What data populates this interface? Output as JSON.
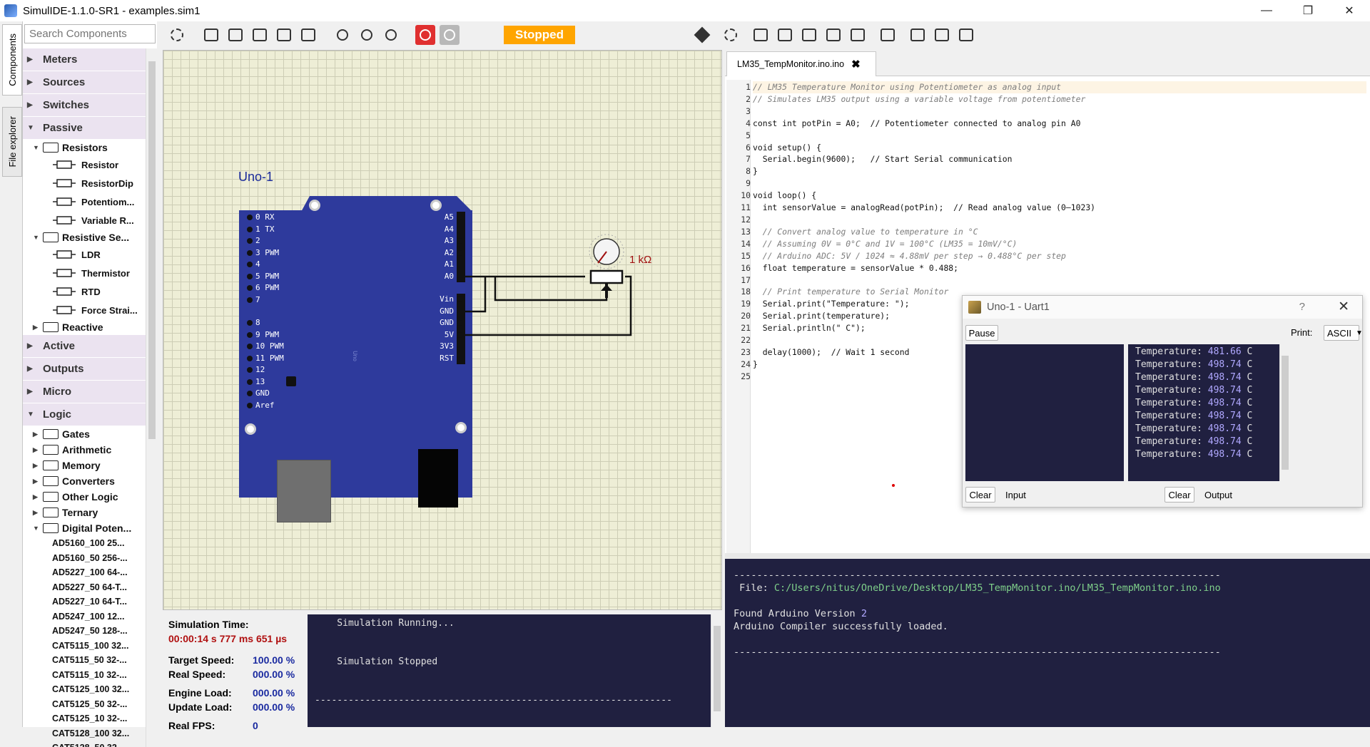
{
  "window": {
    "title": "SimulIDE-1.1.0-SR1 - examples.sim1",
    "minimize": "—",
    "maximize": "❐",
    "close": "✕"
  },
  "side_tabs": {
    "components": "Components",
    "file_explorer": "File explorer"
  },
  "search": {
    "placeholder": "Search Components"
  },
  "tree": {
    "categories": [
      "Meters",
      "Sources",
      "Switches",
      "Passive",
      "Active",
      "Outputs",
      "Micro",
      "Logic"
    ],
    "passive_subs": [
      "Resistors",
      "Resistive Se...",
      "Reactive"
    ],
    "resistor_items": [
      "Resistor",
      "ResistorDip",
      "Potentiom...",
      "Variable R..."
    ],
    "resistive_items": [
      "LDR",
      "Thermistor",
      "RTD",
      "Force Strai..."
    ],
    "logic_subs": [
      "Gates",
      "Arithmetic",
      "Memory",
      "Converters",
      "Other Logic",
      "Ternary",
      "Digital Poten..."
    ],
    "digipot_items": [
      "AD5160_100  25...",
      "AD5160_50  256-...",
      "AD5227_100  64-...",
      "AD5227_50  64-T...",
      "AD5227_10  64-T...",
      "AD5247_100  12...",
      "AD5247_50  128-...",
      "CAT5115_100  32...",
      "CAT5115_50  32-...",
      "CAT5115_10  32-...",
      "CAT5125_100  32...",
      "CAT5125_50  32-...",
      "CAT5125_10  32-...",
      "CAT5128_100  32...",
      "CAT5128_50  32-..."
    ]
  },
  "sim_toolbar": {
    "status": "Stopped"
  },
  "circuit": {
    "board_label": "Uno-1",
    "left_pins": [
      "0 RX",
      "1 TX",
      "2",
      "3 PWM",
      "4",
      "5 PWM",
      "6 PWM",
      "7"
    ],
    "left_pins2": [
      "8",
      "9 PWM",
      "10 PWM",
      "11 PWM",
      "12",
      "13",
      "GND",
      "Aref"
    ],
    "right_pins": [
      "A5",
      "A4",
      "A3",
      "A2",
      "A1",
      "A0"
    ],
    "right_pins2": [
      "Vin",
      "GND",
      "GND",
      "5V",
      "3V3",
      "RST"
    ],
    "pot_value": "1 kΩ",
    "board_text": "Uno"
  },
  "editor": {
    "tab_label": "LM35_TempMonitor.ino.ino",
    "tab_close": "✖",
    "line_numbers": [
      "1",
      "2",
      "3",
      "4",
      "5",
      "6",
      "7",
      "8",
      "9",
      "10",
      "11",
      "12",
      "13",
      "14",
      "15",
      "16",
      "17",
      "18",
      "19",
      "20",
      "21",
      "22",
      "23",
      "24",
      "25"
    ],
    "code": [
      "// LM35 Temperature Monitor using Potentiometer as analog input",
      "// Simulates LM35 output using a variable voltage from potentiometer",
      "",
      "const int potPin = A0;  // Potentiometer connected to analog pin A0",
      "",
      "void setup() {",
      "  Serial.begin(9600);   // Start Serial communication",
      "}",
      "",
      "void loop() {",
      "  int sensorValue = analogRead(potPin);  // Read analog value (0–1023)",
      "",
      "  // Convert analog value to temperature in °C",
      "  // Assuming 0V = 0°C and 1V = 100°C (LM35 = 10mV/°C)",
      "  // Arduino ADC: 5V / 1024 ≈ 4.88mV per step → 0.488°C per step",
      "  float temperature = sensorValue * 0.488;",
      "",
      "  // Print temperature to Serial Monitor",
      "  Serial.print(\"Temperature: \");",
      "  Serial.print(temperature);",
      "  Serial.println(\" C\");",
      "",
      "  delay(1000);  // Wait 1 second",
      "}",
      ""
    ]
  },
  "uart": {
    "title": "Uno-1 - Uart1",
    "help": "?",
    "close": "✕",
    "pause": "Pause",
    "print_label": "Print:",
    "print_mode": "ASCII",
    "input_label": "Input",
    "output_label": "Output",
    "clear": "Clear",
    "output_prefix": "Temperature:",
    "output_unit": "C",
    "output_values": [
      "481.66",
      "498.74",
      "498.74",
      "498.74",
      "498.74",
      "498.74",
      "498.74",
      "498.74",
      "498.74"
    ]
  },
  "status": {
    "sim_time_label": "Simulation Time:",
    "sim_time_value": "00:00:14 s  777 ms  651 µs",
    "target_speed_label": "Target Speed:",
    "target_speed_value": "100.00 %",
    "real_speed_label": "Real Speed:",
    "real_speed_value": "000.00 %",
    "engine_load_label": "Engine Load:",
    "engine_load_value": "000.00 %",
    "update_load_label": "Update Load:",
    "update_load_value": "000.00 %",
    "real_fps_label": "Real FPS:",
    "real_fps_value": "0"
  },
  "sim_log": [
    "    Simulation Running...",
    "",
    "",
    "    Simulation Stopped",
    "",
    "",
    "----------------------------------------------------------------"
  ],
  "compiler_log": {
    "rule": "------------------------------------------------------------------------------------",
    "file_label": " File: ",
    "file_path": "C:/Users/nitus/OneDrive/Desktop/LM35_TempMonitor.ino/LM35_TempMonitor.ino.ino",
    "found": "Found Arduino Version ",
    "version": "2",
    "loaded": "Arduino Compiler successfully loaded."
  },
  "colors": {
    "accent_stopped": "#ffa500",
    "terminal_bg": "#202040",
    "board": "#2e3a9c"
  }
}
